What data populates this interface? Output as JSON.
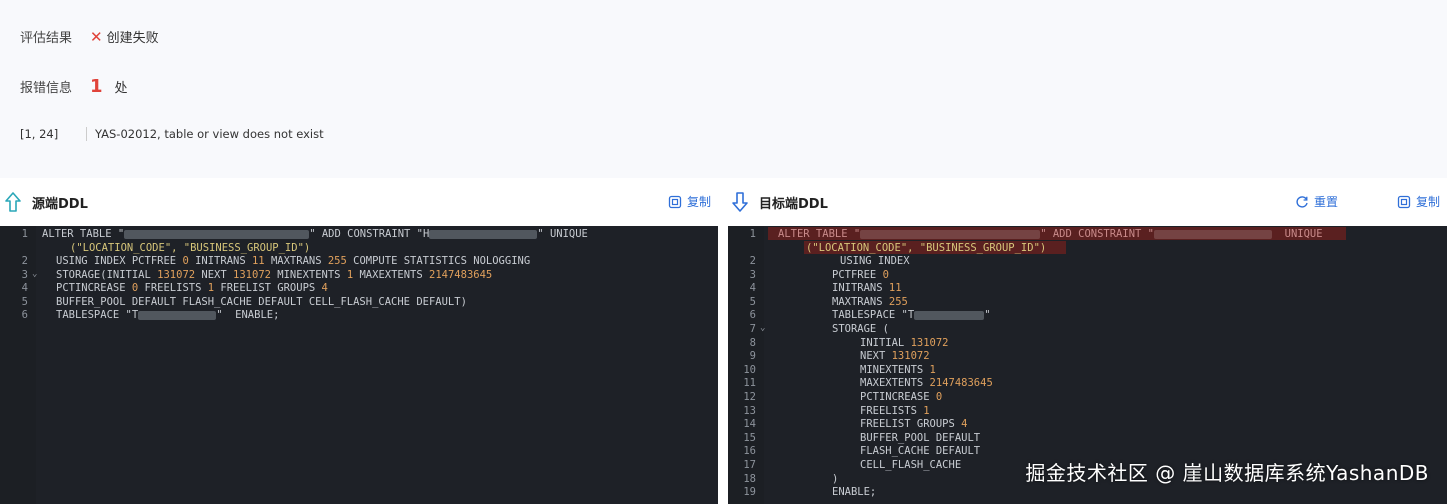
{
  "summary": {
    "result_label": "评估结果",
    "result_status": "创建失败",
    "error_label": "报错信息",
    "error_count": "1",
    "error_unit": "处",
    "error_position": "[1, 24]",
    "error_message": "YAS-02012, table or view does not exist"
  },
  "source_panel": {
    "title": "源端DDL",
    "copy_label": "复制",
    "line_numbers": [
      "1",
      "",
      "2",
      "3",
      "4",
      "5",
      "6"
    ],
    "lines": [
      "ALTER TABLE \"",
      "(\"LOCATION_CODE\", \"BUSINESS_GROUP_ID\")",
      "USING INDEX PCTFREE 0 INITRANS 11 MAXTRANS 255 COMPUTE STATISTICS NOLOGGING",
      "STORAGE(INITIAL 131072 NEXT 131072 MINEXTENTS 1 MAXEXTENTS 2147483645",
      "PCTINCREASE 0 FREELISTS 1 FREELIST GROUPS 4",
      "BUFFER_POOL DEFAULT FLASH_CACHE DEFAULT CELL_FLASH_CACHE DEFAULT)",
      "TABLESPACE \"T"
    ],
    "line1_mid": "\" ADD CONSTRAINT \"H",
    "line1_end": "\" UNIQUE",
    "line6_end": "\"  ENABLE;"
  },
  "target_panel": {
    "title": "目标端DDL",
    "reset_label": "重置",
    "copy_label": "复制",
    "line_numbers": [
      "1",
      "",
      "2",
      "3",
      "4",
      "5",
      "6",
      "7",
      "8",
      "9",
      "10",
      "11",
      "12",
      "13",
      "14",
      "15",
      "16",
      "17",
      "18",
      "19"
    ],
    "line1_start": "ALTER TABLE \"",
    "line1_mid": "\" ADD CONSTRAINT \"",
    "line1_end": "UNIQUE",
    "line1b": "(\"LOCATION_CODE\", \"BUSINESS_GROUP_ID\")",
    "lines": [
      "USING INDEX",
      "PCTFREE 0",
      "INITRANS 11",
      "MAXTRANS 255",
      "TABLESPACE \"T",
      "STORAGE (",
      "INITIAL 131072",
      "NEXT 131072",
      "MINEXTENTS 1",
      "MAXEXTENTS 2147483645",
      "PCTINCREASE 0",
      "FREELISTS 1",
      "FREELIST GROUPS 4",
      "BUFFER_POOL DEFAULT",
      "FLASH_CACHE DEFAULT",
      "CELL_FLASH_CACHE",
      ")",
      "ENABLE;"
    ],
    "line6_end": "\""
  },
  "watermark": "掘金技术社区 @ 崖山数据库系统YashanDB",
  "colors": {
    "fail": "#e0433a",
    "link": "#2f6fd8",
    "editor_bg": "#1e2127",
    "highlight": "#5a2020"
  }
}
